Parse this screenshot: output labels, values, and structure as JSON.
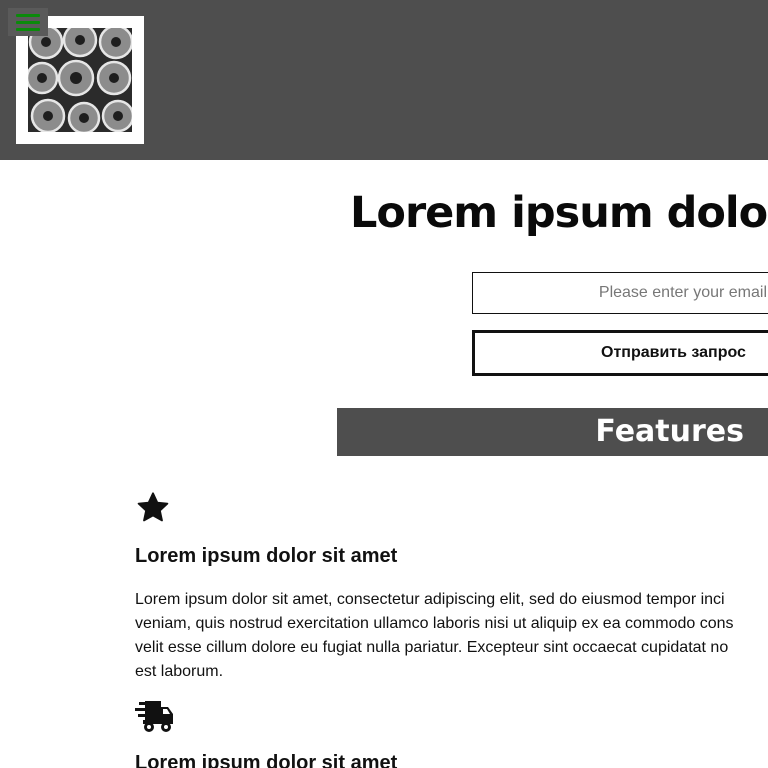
{
  "header": {
    "menu_icon": "hamburger-menu-icon",
    "accent_color": "#0b8a0b",
    "logo_alt": "logo image"
  },
  "hero": {
    "title": "Lorem ipsum dolo",
    "email_placeholder": "Please enter your email",
    "submit_label": "Отправить запрос"
  },
  "features": {
    "title": "Features",
    "items": [
      {
        "icon": "star-icon",
        "heading": "Lorem ipsum dolor sit amet",
        "body_lines": [
          "Lorem ipsum dolor sit amet, consectetur adipiscing elit, sed do eiusmod tempor inci",
          "veniam, quis nostrud exercitation ullamco laboris nisi ut aliquip ex ea commodo cons",
          "velit esse cillum dolore eu fugiat nulla pariatur. Excepteur sint occaecat cupidatat no",
          "est laborum."
        ]
      },
      {
        "icon": "delivery-truck-icon",
        "heading": "Lorem ipsum dolor sit amet"
      }
    ]
  }
}
